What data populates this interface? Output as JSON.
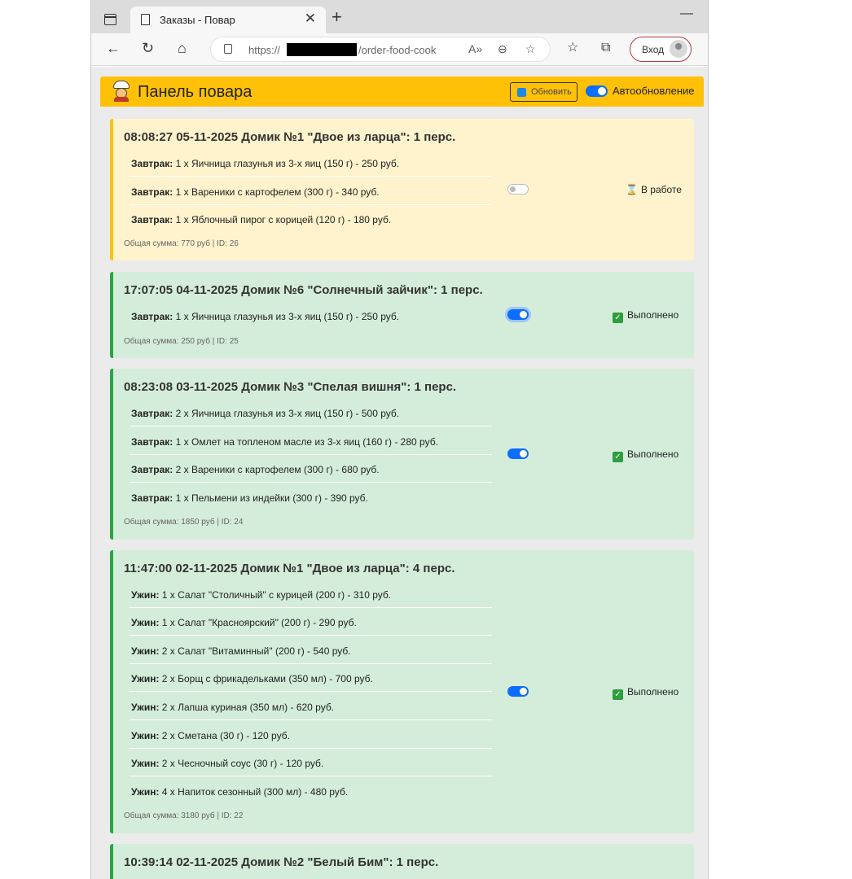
{
  "browser": {
    "tab_title": "Заказы - Повар",
    "url_prefix": "https://",
    "url_suffix": "/order-food-cook",
    "login_label": "Вход"
  },
  "header": {
    "title": "Панель повара",
    "refresh_label": "Обновить",
    "autoupdate_label": "Автообновление"
  },
  "colors": {
    "header": "#ffc107",
    "done_bg": "#d4edda",
    "done_border": "#28a745",
    "working_bg": "#fff3cd",
    "working_border": "#ffc107",
    "toggle_on": "#0d6efd"
  },
  "orders": [
    {
      "title": "08:08:27 05-11-2025 Домик №1 \"Двое из ларца\": 1 перс.",
      "items": [
        {
          "meal": "Завтрак:",
          "text": "1 x Яичница глазунья из 3-х яиц (150 г) - 250 руб."
        },
        {
          "meal": "Завтрак:",
          "text": "1 x Вареники с картофелем (300 г) - 340 руб."
        },
        {
          "meal": "Завтрак:",
          "text": "1 x Яблочный пирог с корицей (120 г) - 180 руб."
        }
      ],
      "total": "Общая сумма: 770 руб | ID: 26",
      "status": "В работе",
      "done": false
    },
    {
      "title": "17:07:05 04-11-2025 Домик №6 \"Солнечный зайчик\": 1 перс.",
      "items": [
        {
          "meal": "Завтрак:",
          "text": "1 x Яичница глазунья из 3-х яиц (150 г) - 250 руб."
        }
      ],
      "total": "Общая сумма: 250 руб | ID: 25",
      "status": "Выполнено",
      "done": true
    },
    {
      "title": "08:23:08 03-11-2025 Домик №3 \"Спелая вишня\": 1 перс.",
      "items": [
        {
          "meal": "Завтрак:",
          "text": "2 x Яичница глазунья из 3-х яиц (150 г) - 500 руб."
        },
        {
          "meal": "Завтрак:",
          "text": "1 x Омлет на топленом масле из 3-х яиц (160 г) - 280 руб."
        },
        {
          "meal": "Завтрак:",
          "text": "2 x Вареники с картофелем (300 г) - 680 руб."
        },
        {
          "meal": "Завтрак:",
          "text": "1 x Пельмени из индейки (300 г) - 390 руб."
        }
      ],
      "total": "Общая сумма: 1850 руб | ID: 24",
      "status": "Выполнено",
      "done": true
    },
    {
      "title": "11:47:00 02-11-2025 Домик №1 \"Двое из ларца\": 4 перс.",
      "items": [
        {
          "meal": "Ужин:",
          "text": "1 x Салат \"Столичный\" с курицей (200 г) - 310 руб."
        },
        {
          "meal": "Ужин:",
          "text": "1 x Салат \"Красноярский\" (200 г) - 290 руб."
        },
        {
          "meal": "Ужин:",
          "text": "2 x Салат \"Витаминный\" (200 г) - 540 руб."
        },
        {
          "meal": "Ужин:",
          "text": "2 x Борщ с фрикадельками (350 мл) - 700 руб."
        },
        {
          "meal": "Ужин:",
          "text": "2 x Лапша куриная (350 мл) - 620 руб."
        },
        {
          "meal": "Ужин:",
          "text": "2 x Сметана (30 г) - 120 руб."
        },
        {
          "meal": "Ужин:",
          "text": "2 x Чесночный соус (30 г) - 120 руб."
        },
        {
          "meal": "Ужин:",
          "text": "4 x Напиток сезонный (300 мл) - 480 руб."
        }
      ],
      "total": "Общая сумма: 3180 руб | ID: 22",
      "status": "Выполнено",
      "done": true
    },
    {
      "title": "10:39:14 02-11-2025 Домик №2 \"Белый Бим\": 1 перс.",
      "items": [],
      "total": "",
      "status": "",
      "done": true
    }
  ]
}
